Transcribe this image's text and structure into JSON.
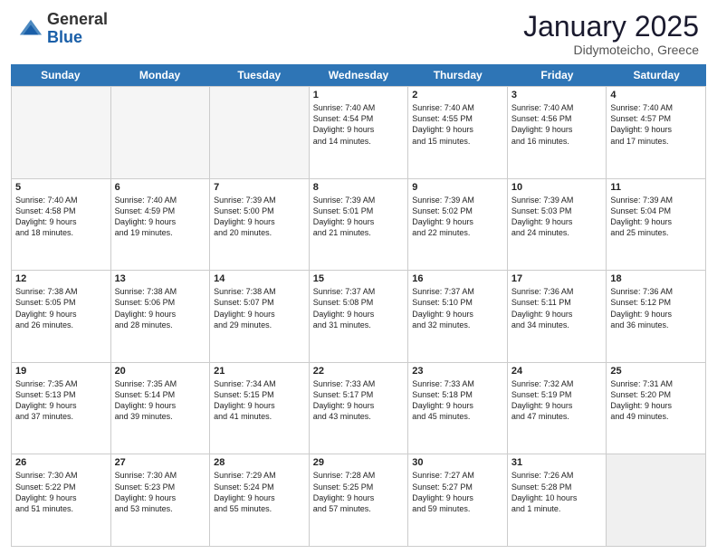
{
  "header": {
    "logo_general": "General",
    "logo_blue": "Blue",
    "month_title": "January 2025",
    "location": "Didymoteicho, Greece"
  },
  "days_of_week": [
    "Sunday",
    "Monday",
    "Tuesday",
    "Wednesday",
    "Thursday",
    "Friday",
    "Saturday"
  ],
  "weeks": [
    [
      {
        "day": "",
        "empty": true
      },
      {
        "day": "",
        "empty": true
      },
      {
        "day": "",
        "empty": true
      },
      {
        "day": "1",
        "lines": [
          "Sunrise: 7:40 AM",
          "Sunset: 4:54 PM",
          "Daylight: 9 hours",
          "and 14 minutes."
        ]
      },
      {
        "day": "2",
        "lines": [
          "Sunrise: 7:40 AM",
          "Sunset: 4:55 PM",
          "Daylight: 9 hours",
          "and 15 minutes."
        ]
      },
      {
        "day": "3",
        "lines": [
          "Sunrise: 7:40 AM",
          "Sunset: 4:56 PM",
          "Daylight: 9 hours",
          "and 16 minutes."
        ]
      },
      {
        "day": "4",
        "lines": [
          "Sunrise: 7:40 AM",
          "Sunset: 4:57 PM",
          "Daylight: 9 hours",
          "and 17 minutes."
        ]
      }
    ],
    [
      {
        "day": "5",
        "lines": [
          "Sunrise: 7:40 AM",
          "Sunset: 4:58 PM",
          "Daylight: 9 hours",
          "and 18 minutes."
        ]
      },
      {
        "day": "6",
        "lines": [
          "Sunrise: 7:40 AM",
          "Sunset: 4:59 PM",
          "Daylight: 9 hours",
          "and 19 minutes."
        ]
      },
      {
        "day": "7",
        "lines": [
          "Sunrise: 7:39 AM",
          "Sunset: 5:00 PM",
          "Daylight: 9 hours",
          "and 20 minutes."
        ]
      },
      {
        "day": "8",
        "lines": [
          "Sunrise: 7:39 AM",
          "Sunset: 5:01 PM",
          "Daylight: 9 hours",
          "and 21 minutes."
        ]
      },
      {
        "day": "9",
        "lines": [
          "Sunrise: 7:39 AM",
          "Sunset: 5:02 PM",
          "Daylight: 9 hours",
          "and 22 minutes."
        ]
      },
      {
        "day": "10",
        "lines": [
          "Sunrise: 7:39 AM",
          "Sunset: 5:03 PM",
          "Daylight: 9 hours",
          "and 24 minutes."
        ]
      },
      {
        "day": "11",
        "lines": [
          "Sunrise: 7:39 AM",
          "Sunset: 5:04 PM",
          "Daylight: 9 hours",
          "and 25 minutes."
        ]
      }
    ],
    [
      {
        "day": "12",
        "lines": [
          "Sunrise: 7:38 AM",
          "Sunset: 5:05 PM",
          "Daylight: 9 hours",
          "and 26 minutes."
        ]
      },
      {
        "day": "13",
        "lines": [
          "Sunrise: 7:38 AM",
          "Sunset: 5:06 PM",
          "Daylight: 9 hours",
          "and 28 minutes."
        ]
      },
      {
        "day": "14",
        "lines": [
          "Sunrise: 7:38 AM",
          "Sunset: 5:07 PM",
          "Daylight: 9 hours",
          "and 29 minutes."
        ]
      },
      {
        "day": "15",
        "lines": [
          "Sunrise: 7:37 AM",
          "Sunset: 5:08 PM",
          "Daylight: 9 hours",
          "and 31 minutes."
        ]
      },
      {
        "day": "16",
        "lines": [
          "Sunrise: 7:37 AM",
          "Sunset: 5:10 PM",
          "Daylight: 9 hours",
          "and 32 minutes."
        ]
      },
      {
        "day": "17",
        "lines": [
          "Sunrise: 7:36 AM",
          "Sunset: 5:11 PM",
          "Daylight: 9 hours",
          "and 34 minutes."
        ]
      },
      {
        "day": "18",
        "lines": [
          "Sunrise: 7:36 AM",
          "Sunset: 5:12 PM",
          "Daylight: 9 hours",
          "and 36 minutes."
        ]
      }
    ],
    [
      {
        "day": "19",
        "lines": [
          "Sunrise: 7:35 AM",
          "Sunset: 5:13 PM",
          "Daylight: 9 hours",
          "and 37 minutes."
        ]
      },
      {
        "day": "20",
        "lines": [
          "Sunrise: 7:35 AM",
          "Sunset: 5:14 PM",
          "Daylight: 9 hours",
          "and 39 minutes."
        ]
      },
      {
        "day": "21",
        "lines": [
          "Sunrise: 7:34 AM",
          "Sunset: 5:15 PM",
          "Daylight: 9 hours",
          "and 41 minutes."
        ]
      },
      {
        "day": "22",
        "lines": [
          "Sunrise: 7:33 AM",
          "Sunset: 5:17 PM",
          "Daylight: 9 hours",
          "and 43 minutes."
        ]
      },
      {
        "day": "23",
        "lines": [
          "Sunrise: 7:33 AM",
          "Sunset: 5:18 PM",
          "Daylight: 9 hours",
          "and 45 minutes."
        ]
      },
      {
        "day": "24",
        "lines": [
          "Sunrise: 7:32 AM",
          "Sunset: 5:19 PM",
          "Daylight: 9 hours",
          "and 47 minutes."
        ]
      },
      {
        "day": "25",
        "lines": [
          "Sunrise: 7:31 AM",
          "Sunset: 5:20 PM",
          "Daylight: 9 hours",
          "and 49 minutes."
        ]
      }
    ],
    [
      {
        "day": "26",
        "lines": [
          "Sunrise: 7:30 AM",
          "Sunset: 5:22 PM",
          "Daylight: 9 hours",
          "and 51 minutes."
        ]
      },
      {
        "day": "27",
        "lines": [
          "Sunrise: 7:30 AM",
          "Sunset: 5:23 PM",
          "Daylight: 9 hours",
          "and 53 minutes."
        ]
      },
      {
        "day": "28",
        "lines": [
          "Sunrise: 7:29 AM",
          "Sunset: 5:24 PM",
          "Daylight: 9 hours",
          "and 55 minutes."
        ]
      },
      {
        "day": "29",
        "lines": [
          "Sunrise: 7:28 AM",
          "Sunset: 5:25 PM",
          "Daylight: 9 hours",
          "and 57 minutes."
        ]
      },
      {
        "day": "30",
        "lines": [
          "Sunrise: 7:27 AM",
          "Sunset: 5:27 PM",
          "Daylight: 9 hours",
          "and 59 minutes."
        ]
      },
      {
        "day": "31",
        "lines": [
          "Sunrise: 7:26 AM",
          "Sunset: 5:28 PM",
          "Daylight: 10 hours",
          "and 1 minute."
        ]
      },
      {
        "day": "",
        "empty": true,
        "shaded": true
      }
    ]
  ]
}
